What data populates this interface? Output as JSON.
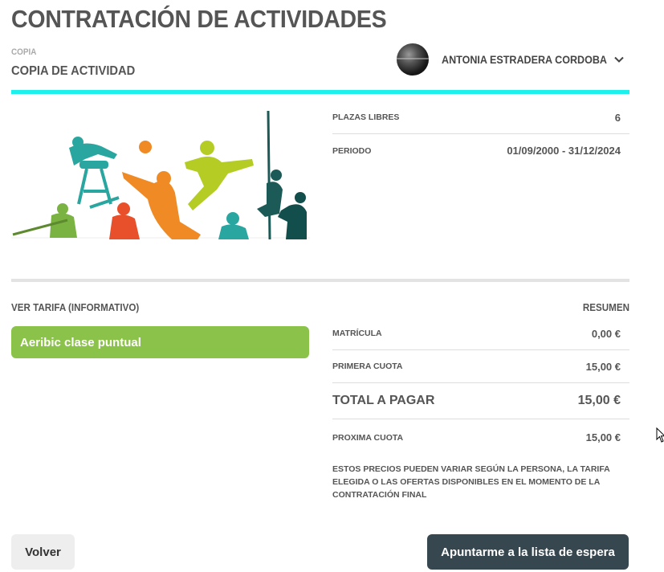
{
  "page": {
    "title": "CONTRATACIÓN DE ACTIVIDADES",
    "caption": "COPIA",
    "subtitle": "COPIA DE ACTIVIDAD"
  },
  "user": {
    "name": "ANTONIA ESTRADERA CORDOBA",
    "avatar_icon": "avatar-sphere-icon",
    "menu_icon": "chevron-down-icon"
  },
  "colors": {
    "accent": "#1ef0ee",
    "tarifa": "#8bc34a",
    "primary_button": "#37474f",
    "secondary_button": "#eeeeee"
  },
  "activity": {
    "image_icon": "sports-silhouettes-illustration"
  },
  "info": {
    "rows": [
      {
        "label": "PLAZAS LIBRES",
        "value": "6"
      },
      {
        "label": "PERIODO",
        "value": "01/09/2000 - 31/12/2024"
      }
    ]
  },
  "tarifa": {
    "label": "VER TARIFA (INFORMATIVO)",
    "option": "Aeribic clase puntual"
  },
  "summary": {
    "label": "RESUMEN",
    "rows": [
      {
        "label": "MATRÍCULA",
        "value": "0,00 €"
      },
      {
        "label": "PRIMERA CUOTA",
        "value": "15,00 €"
      },
      {
        "label": "TOTAL A PAGAR",
        "value": "15,00 €"
      },
      {
        "label": "PROXIMA CUOTA",
        "value": "15,00 €"
      }
    ],
    "disclaimer": "ESTOS PRECIOS PUEDEN VARIAR SEGÚN LA PERSONA, LA TARIFA ELEGIDA O LAS OFERTAS DISPONIBLES EN EL MOMENTO DE LA CONTRATACIÓN FINAL"
  },
  "actions": {
    "back": "Volver",
    "waitlist": "Apuntarme a la lista de espera"
  }
}
